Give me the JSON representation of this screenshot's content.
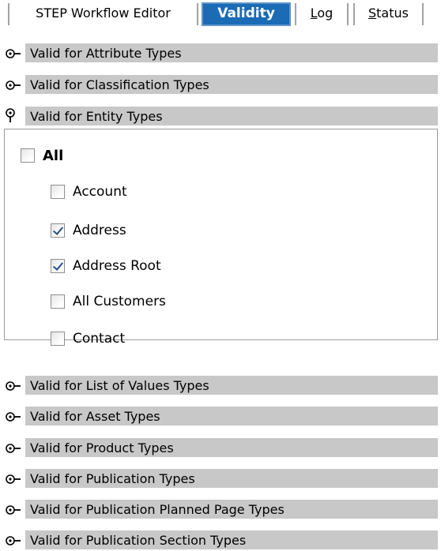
{
  "tabs": [
    {
      "label": "STEP Workflow Editor",
      "active": false
    },
    {
      "label": "Validity",
      "active": true
    },
    {
      "label": "Log",
      "active": false,
      "mnemonic": "L",
      "rest": "og"
    },
    {
      "label": "Status",
      "active": false,
      "mnemonic": "S",
      "rest": "tatus"
    }
  ],
  "sections_before": [
    {
      "label": "Valid for Attribute Types",
      "expanded": false
    },
    {
      "label": "Valid for Classification Types",
      "expanded": false
    },
    {
      "label": "Valid for Entity Types",
      "expanded": true
    }
  ],
  "entity_types": {
    "all_label": "All",
    "all_checked": false,
    "items": [
      {
        "label": "Account",
        "checked": false
      },
      {
        "label": "Address",
        "checked": true
      },
      {
        "label": "Address Root",
        "checked": true
      },
      {
        "label": "All Customers",
        "checked": false
      },
      {
        "label": "Contact",
        "checked": false
      }
    ]
  },
  "sections_after": [
    {
      "label": "Valid for List of Values Types",
      "expanded": false
    },
    {
      "label": "Valid for Asset Types",
      "expanded": false
    },
    {
      "label": "Valid for Product Types",
      "expanded": false
    },
    {
      "label": "Valid for Publication Types",
      "expanded": false
    },
    {
      "label": "Valid for Publication Planned Page Types",
      "expanded": false
    },
    {
      "label": "Valid for Publication Section Types",
      "expanded": false
    }
  ],
  "icons": {
    "collapsed": "expand-arrow-icon",
    "expanded": "collapse-pin-icon"
  },
  "colors": {
    "active_tab": "#1b6bb5",
    "section_bar": "#c8c8c8",
    "check_mark": "#2a4f8c"
  }
}
